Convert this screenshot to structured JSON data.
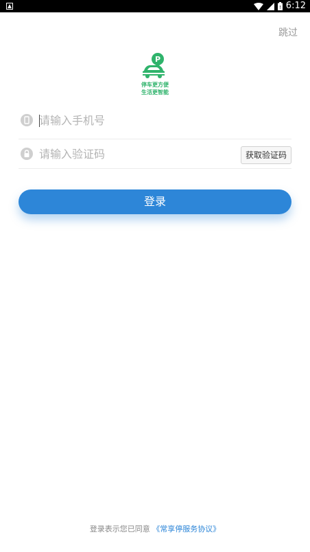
{
  "status_bar": {
    "time": "6:12",
    "icons": [
      "notification-icon",
      "wifi-icon",
      "signal-icon",
      "battery-icon"
    ]
  },
  "header": {
    "skip_label": "跳过"
  },
  "logo": {
    "badge_letter": "P",
    "line1": "停车更方便",
    "line2": "生活更智能",
    "color": "#2fb36b"
  },
  "form": {
    "phone": {
      "placeholder": "请输入手机号",
      "value": "",
      "icon": "phone-icon"
    },
    "code": {
      "placeholder": "请输入验证码",
      "value": "",
      "icon": "lock-icon",
      "get_code_label": "获取验证码"
    },
    "login_label": "登录"
  },
  "footer": {
    "prefix": "登录表示您已同意",
    "agreement": "《常享停服务协议》"
  },
  "colors": {
    "accent": "#2d86d8",
    "brand_green": "#2fb36b",
    "placeholder": "#b4b4b4"
  }
}
